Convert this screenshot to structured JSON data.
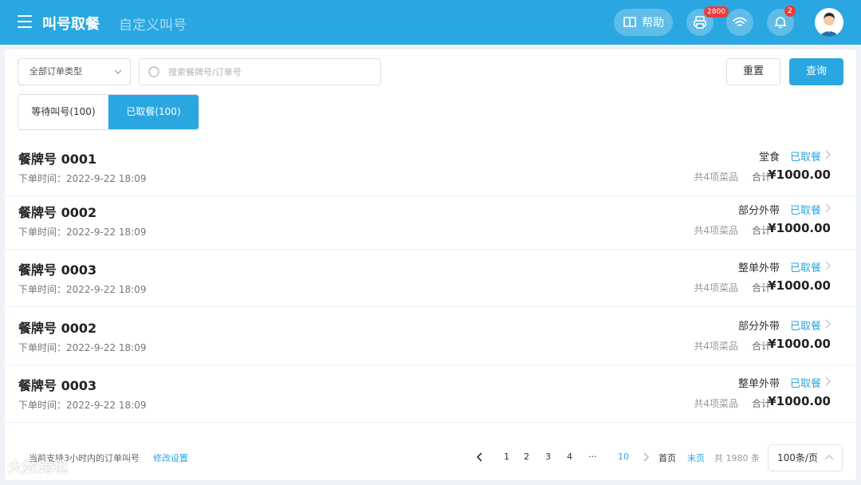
{
  "header": {
    "active_tab": "叫号取餐",
    "other_tab": "自定义叫号",
    "help_label": "帮助",
    "printer_badge": "2800",
    "bell_badge": "2"
  },
  "filters": {
    "order_type": "全部订单类型",
    "search_placeholder": "搜索餐牌号/订单号",
    "reset_label": "重置",
    "query_label": "查询"
  },
  "tabs": {
    "waiting": "等待叫号(100)",
    "picked": "已取餐(100)"
  },
  "orders": [
    {
      "number": "餐牌号 0001",
      "time": "下单时间：2022-9-22 18:09",
      "kind": "堂食",
      "status": "已取餐",
      "items": "共4项菜品",
      "total_label": "合计",
      "total": "¥1000.00"
    },
    {
      "number": "餐牌号 0002",
      "time": "下单时间：2022-9-22 18:09",
      "kind": "部分外带",
      "status": "已取餐",
      "items": "共4项菜品",
      "total_label": "合计",
      "total": "¥1000.00"
    },
    {
      "number": "餐牌号 0003",
      "time": "下单时间：2022-9-22 18:09",
      "kind": "整单外带",
      "status": "已取餐",
      "items": "共4项菜品",
      "total_label": "合计",
      "total": "¥1000.00"
    },
    {
      "number": "餐牌号 0002",
      "time": "下单时间：2022-9-22 18:09",
      "kind": "部分外带",
      "status": "已取餐",
      "items": "共4项菜品",
      "total_label": "合计",
      "total": "¥1000.00"
    },
    {
      "number": "餐牌号 0003",
      "time": "下单时间：2022-9-22 18:09",
      "kind": "整单外带",
      "status": "已取餐",
      "items": "共4项菜品",
      "total_label": "合计",
      "total": "¥1000.00"
    }
  ],
  "footer": {
    "note": "当前支持3小时内的订单叫号",
    "settings_link": "修改设置",
    "pages": [
      "1",
      "2",
      "3",
      "4",
      "···",
      "10"
    ],
    "first": "首页",
    "last": "末页",
    "total": "共 1980 条",
    "page_size": "100条/页"
  },
  "watermark": "大数跨境",
  "colors": {
    "primary": "#2aa7e0",
    "badge": "#ee3b3b"
  }
}
